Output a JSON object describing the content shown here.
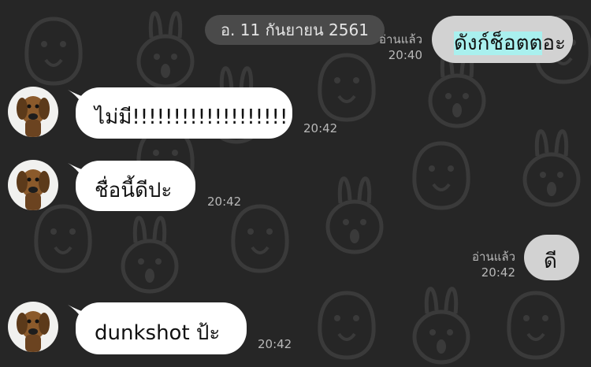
{
  "chat": {
    "date_separator": "อ. 11 กันยายน 2561",
    "messages": [
      {
        "direction": "outgoing",
        "text_pre": "ดังก์ช็อต",
        "text_highlight": "ต",
        "text_post": "อะ",
        "read_label": "อ่านแล้ว",
        "time": "20:40"
      },
      {
        "direction": "incoming",
        "text": "ไม่มี!!!!!!!!!!!!!!!!!!!",
        "time": "20:42"
      },
      {
        "direction": "incoming",
        "text": "ชื่อนี้ดีปะ",
        "time": "20:42"
      },
      {
        "direction": "outgoing",
        "text": "ดี",
        "read_label": "อ่านแล้ว",
        "time": "20:42"
      },
      {
        "direction": "incoming",
        "text": "dunkshot ป้ะ",
        "time": "20:42"
      }
    ]
  },
  "colors": {
    "background": "#262626",
    "bubble_incoming": "#ffffff",
    "bubble_outgoing": "#d2d2d2",
    "text_highlight": "#a9f0ee",
    "meta_text": "#b8b8b8"
  },
  "icons": {
    "avatar": "cartoon-dog-avatar",
    "wallpaper": "cartoon-animal-faces-pattern"
  }
}
